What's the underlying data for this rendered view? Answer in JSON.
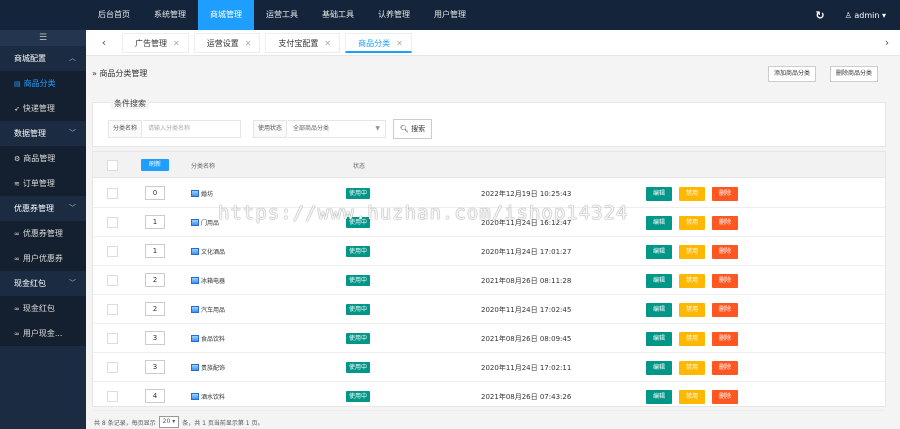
{
  "topnav": {
    "items": [
      {
        "label": "后台首页",
        "active": false
      },
      {
        "label": "系统管理",
        "active": false
      },
      {
        "label": "商城管理",
        "active": true
      },
      {
        "label": "运营工具",
        "active": false
      },
      {
        "label": "基础工具",
        "active": false
      },
      {
        "label": "认养管理",
        "active": false
      },
      {
        "label": "用户管理",
        "active": false
      }
    ],
    "user": "admin"
  },
  "sidebar": {
    "toggle_icon": "menu-icon",
    "sections": [
      {
        "label": "商城配置",
        "items": [
          {
            "label": "商品分类",
            "icon": "file-icon",
            "active": true
          },
          {
            "label": "快递管理",
            "icon": "send-icon",
            "active": false
          }
        ]
      },
      {
        "label": "数据管理",
        "items": [
          {
            "label": "商品管理",
            "icon": "gear-icon",
            "active": false
          },
          {
            "label": "订单管理",
            "icon": "sliders-icon",
            "active": false
          }
        ]
      },
      {
        "label": "优惠券管理",
        "items": [
          {
            "label": "优惠券管理",
            "icon": "link-icon",
            "active": false
          },
          {
            "label": "用户优惠券",
            "icon": "link-icon",
            "active": false
          }
        ]
      },
      {
        "label": "现金红包",
        "items": [
          {
            "label": "现金红包",
            "icon": "link-icon",
            "active": false
          },
          {
            "label": "用户现金...",
            "icon": "link-icon",
            "active": false
          }
        ]
      }
    ]
  },
  "tabs": [
    {
      "label": "广告管理",
      "active": false
    },
    {
      "label": "运营设置",
      "active": false
    },
    {
      "label": "支付宝配置",
      "active": false
    },
    {
      "label": "商品分类",
      "active": true
    }
  ],
  "page": {
    "title": "商品分类管理",
    "add_button": "添加商品分类",
    "delete_button": "删除商品分类"
  },
  "search": {
    "legend": "条件搜索",
    "name_label": "分类名称",
    "name_placeholder": "请输入分类名称",
    "status_label": "使用状态",
    "status_value": "全部商品分类",
    "search_button": "搜索"
  },
  "table": {
    "refresh_button": "刷新",
    "headers": {
      "name": "分类名称",
      "status": "状态"
    },
    "rows": [
      {
        "sort": "0",
        "name": "婚坊",
        "status": "使用中",
        "time": "2022年12月19日 10:25:43"
      },
      {
        "sort": "1",
        "name": "门用品",
        "status": "使用中",
        "time": "2020年11月24日 16:12:47"
      },
      {
        "sort": "1",
        "name": "文化酒品",
        "status": "使用中",
        "time": "2020年11月24日 17:01:27"
      },
      {
        "sort": "2",
        "name": "冰箱电器",
        "status": "使用中",
        "time": "2021年08月26日 08:11:28"
      },
      {
        "sort": "2",
        "name": "汽车用品",
        "status": "使用中",
        "time": "2020年11月24日 17:02:45"
      },
      {
        "sort": "3",
        "name": "食品饮料",
        "status": "使用中",
        "time": "2021年08月26日 08:09:45"
      },
      {
        "sort": "3",
        "name": "贵族配饰",
        "status": "使用中",
        "time": "2020年11月24日 17:02:11"
      },
      {
        "sort": "4",
        "name": "酒水饮料",
        "status": "使用中",
        "time": "2021年08月26日 07:43:26"
      }
    ],
    "actions": {
      "edit": "编辑",
      "disable": "禁用",
      "delete": "删除"
    }
  },
  "pager": {
    "prefix": "共 8 条记录，每页显示",
    "page_size": "20",
    "suffix": "条，共 1 页当前显示第 1 页。"
  },
  "watermark": "https://www.huzhan.com/ishop14324",
  "colors": {
    "topnav_bg": "#14243b",
    "active_blue": "#1e9fff",
    "status_green": "#009688",
    "disable_yellow": "#ffb800",
    "delete_orange": "#ff5722"
  }
}
